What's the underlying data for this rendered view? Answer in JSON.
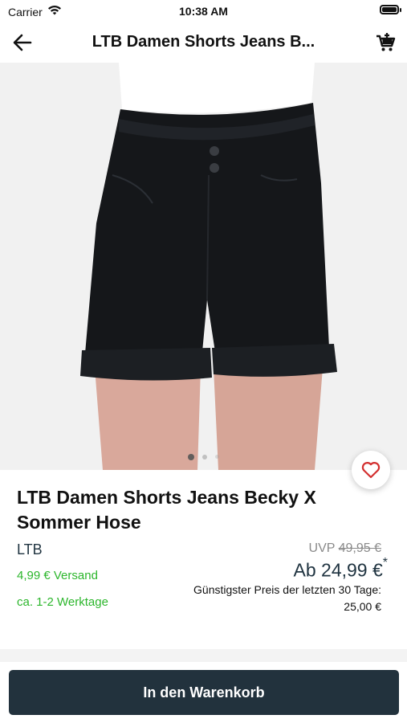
{
  "status": {
    "carrier": "Carrier",
    "time": "10:38 AM"
  },
  "nav": {
    "title": "LTB Damen Shorts Jeans B..."
  },
  "gallery": {
    "image_count": 3,
    "active_index": 0
  },
  "product": {
    "title": "LTB Damen Shorts Jeans Becky X Sommer Hose",
    "brand": "LTB",
    "shipping": "4,99 € Versand",
    "delivery": "ca. 1-2 Werktage",
    "uvp_label": "UVP",
    "uvp_value": "49,95 €",
    "price": "Ab 24,99 €",
    "price_footnote": "*",
    "lowest_label": "Günstigster Preis der letzten 30 Tage:",
    "lowest_value": "25,00 €"
  },
  "actions": {
    "add_to_cart": "In den Warenkorb"
  },
  "colors": {
    "primary": "#22323d",
    "accent_green": "#2cb62c",
    "heart_red": "#d32f2f"
  },
  "icons": [
    "wifi-icon",
    "battery-icon",
    "back-arrow-icon",
    "cart-icon",
    "heart-icon"
  ]
}
